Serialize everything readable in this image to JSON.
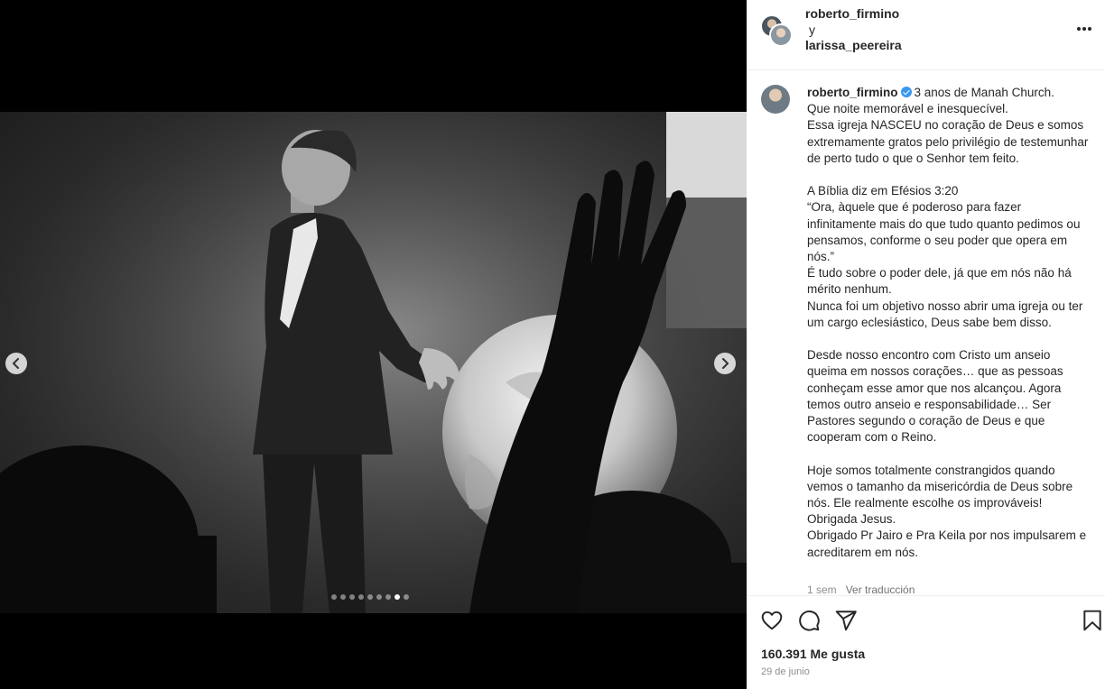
{
  "header": {
    "user1": "roberto_firmino",
    "joiner": "y",
    "user2": "larissa_peereira",
    "more_icon": "more-horizontal-icon"
  },
  "carousel": {
    "prev_icon": "chevron-left-icon",
    "next_icon": "chevron-right-icon",
    "total_slides": 9,
    "active_slide": 8
  },
  "caption": {
    "username": "roberto_firmino",
    "verified_icon": "verified-badge-icon",
    "text": "3 anos de Manah Church.\nQue noite memorável e inesquecível.\nEssa igreja NASCEU no coração de Deus e somos extremamente gratos pelo privilégio de testemunhar de perto tudo o que o Senhor tem feito.\n\nA Bíblia diz em Efésios 3:20\n“Ora, àquele que é poderoso para fazer infinitamente mais do que tudo quanto pedimos ou pensamos, conforme o seu poder que opera em nós.”\nÉ tudo sobre o poder dele, já que em nós não há mérito nenhum.\nNunca foi um objetivo nosso abrir uma igreja ou ter um cargo eclesiástico, Deus sabe bem disso.\n\nDesde nosso encontro com Cristo um anseio queima em nossos corações… que as pessoas conheçam esse amor que nos alcançou. Agora temos outro anseio e responsabilidade… Ser Pastores segundo o coração de Deus e que cooperam com o Reino.\n\nHoje somos totalmente constrangidos quando vemos o tamanho da misericórdia de Deus sobre nós. Ele realmente escolhe os improváveis! Obrigada Jesus.\nObrigado Pr Jairo e Pra Keila por nos impulsarem e acreditarem em nós.",
    "time_ago": "1 sem",
    "translate_label": "Ver traducción"
  },
  "actions": {
    "like_icon": "heart-icon",
    "comment_icon": "comment-icon",
    "share_icon": "send-icon",
    "save_icon": "bookmark-icon",
    "likes_label": "160.391 Me gusta",
    "date": "29 de junio"
  },
  "colors": {
    "verified": "#3897f0",
    "text": "#262626",
    "muted": "#8e8e8e"
  }
}
